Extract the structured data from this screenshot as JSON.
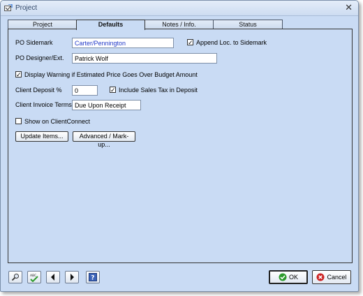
{
  "window": {
    "title": "Project"
  },
  "tabs": [
    {
      "label": "Project",
      "active": false
    },
    {
      "label": "Defaults",
      "active": true
    },
    {
      "label": "Notes / Info.",
      "active": false
    },
    {
      "label": "Status",
      "active": false
    }
  ],
  "form": {
    "po_sidemark_label": "PO Sidemark",
    "po_sidemark_value": "Carter/Pennington",
    "append_loc_label": "Append Loc. to Sidemark",
    "append_loc_checked": true,
    "po_designer_label": "PO Designer/Ext.",
    "po_designer_value": "Patrick Wolf",
    "display_warning_label": "Display Warning if Estimated Price Goes Over Budget Amount",
    "display_warning_checked": true,
    "client_deposit_label": "Client Deposit %",
    "client_deposit_value": "0",
    "include_tax_label": "Include Sales Tax in Deposit",
    "include_tax_checked": true,
    "client_invoice_label": "Client Invoice Terms",
    "client_invoice_value": "Due Upon Receipt",
    "show_clientconnect_label": "Show on ClientConnect",
    "show_clientconnect_checked": false,
    "update_items_label": "Update Items...",
    "advanced_markup_label": "Advanced / Mark-up..."
  },
  "footer": {
    "ok_label": "OK",
    "cancel_label": "Cancel",
    "tools": [
      "search-icon",
      "spellcheck-icon",
      "arrow-left-icon",
      "arrow-right-icon",
      "help-icon"
    ]
  },
  "colors": {
    "panel_bg": "#c9dbf4",
    "field_text_blue": "#2038c8",
    "ok_green": "#2e9b2e",
    "cancel_red": "#cc2222"
  }
}
